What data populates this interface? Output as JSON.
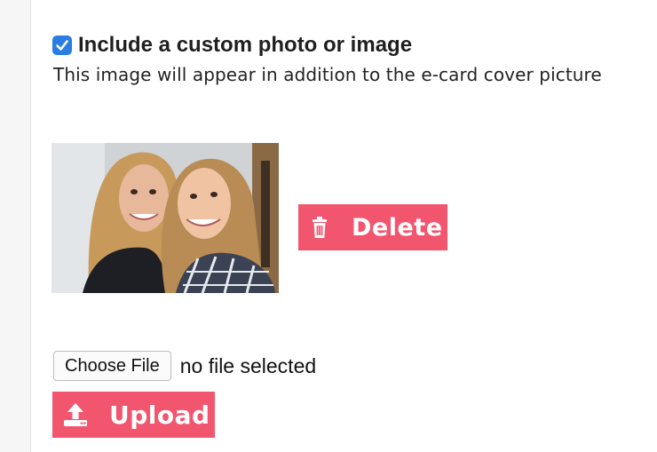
{
  "custom_image": {
    "checkbox_checked": true,
    "title": "Include a custom photo or image",
    "description": "This image will appear in addition to the e-card cover picture"
  },
  "preview": {
    "icon": "photo-preview-two-women"
  },
  "delete_button": {
    "label": "Delete",
    "icon": "trash-icon"
  },
  "file_input": {
    "button_label": "Choose File",
    "status": "no file selected"
  },
  "upload_button": {
    "label": "Upload",
    "icon": "upload-icon"
  },
  "colors": {
    "accent": "#f2566f",
    "checkbox": "#2a7de1"
  }
}
